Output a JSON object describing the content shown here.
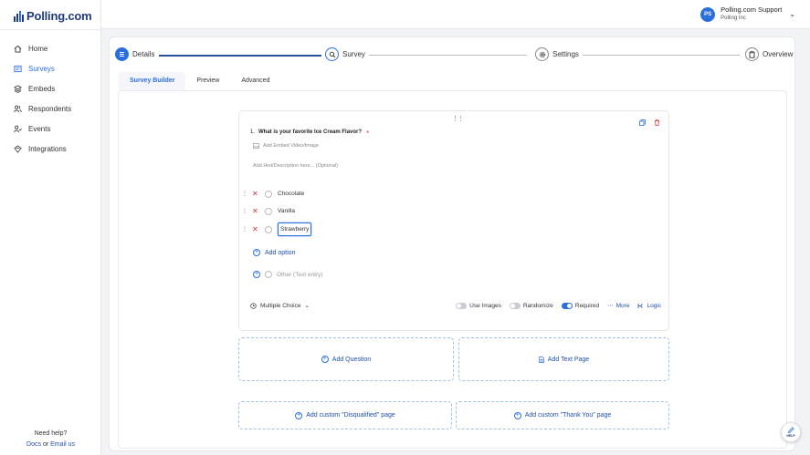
{
  "app": {
    "brand": "Polling.com"
  },
  "sidebar": {
    "items": [
      {
        "label": "Home",
        "icon": "home-icon"
      },
      {
        "label": "Surveys",
        "icon": "survey-icon"
      },
      {
        "label": "Embeds",
        "icon": "layers-icon"
      },
      {
        "label": "Respondents",
        "icon": "users-icon"
      },
      {
        "label": "Events",
        "icon": "events-icon"
      },
      {
        "label": "Integrations",
        "icon": "integrations-icon"
      }
    ],
    "help_title": "Need help?",
    "docs_label": "Docs",
    "or_label": "or",
    "email_label": "Email us"
  },
  "user": {
    "initials": "PS",
    "name": "Polling.com Support",
    "org": "Polling Inc"
  },
  "steps": [
    {
      "label": "Details"
    },
    {
      "label": "Survey"
    },
    {
      "label": "Settings"
    },
    {
      "label": "Overview"
    }
  ],
  "tabs": [
    "Survey Builder",
    "Preview",
    "Advanced"
  ],
  "question": {
    "number": "1.",
    "title": "What is your favorite Ice Cream Flavor?",
    "required_mark": "*",
    "embed_label": "Add Embed Video/Image",
    "hint_placeholder": "Add Hint/Description here... (Optional)",
    "options": [
      "Chocolate",
      "Vanilla",
      "Strawberry"
    ],
    "add_option_label": "Add option",
    "other_label": "Other (Text entry)",
    "type_label": "Multiple Choice",
    "use_images_label": "Use Images",
    "randomize_label": "Randomize",
    "required_label": "Required",
    "more_label": "More",
    "logic_label": "Logic",
    "use_images_on": false,
    "randomize_on": false,
    "required_on": true
  },
  "actions": {
    "add_question": "Add Question",
    "add_text_page": "Add Text Page",
    "add_disqualified": "Add custom \"Disqualified\" page",
    "add_thank_you": "Add custom \"Thank You\" page"
  },
  "help_fab": {
    "label": "HELP"
  },
  "colors": {
    "accent": "#2a6fdb",
    "brand": "#1f3b7a",
    "danger": "#d43030"
  }
}
